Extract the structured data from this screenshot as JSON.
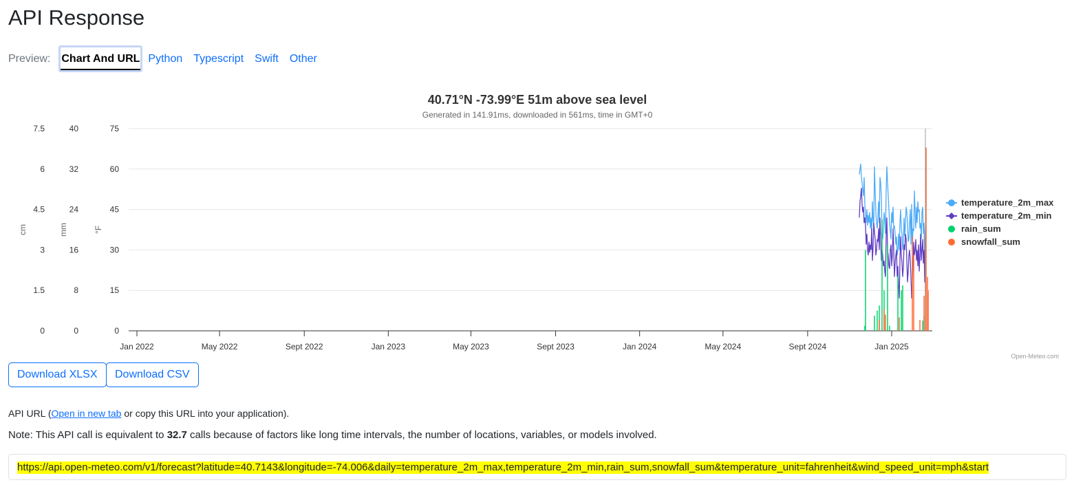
{
  "header": {
    "title": "API Response"
  },
  "tabs": {
    "label": "Preview:",
    "items": [
      "Chart And URL",
      "Python",
      "Typescript",
      "Swift",
      "Other"
    ]
  },
  "buttons": {
    "xlsx": "Download XLSX",
    "csv": "Download CSV"
  },
  "api_url": {
    "prefix": "API URL (",
    "link": "Open in new tab",
    "suffix": " or copy this URL into your application).",
    "url": "https://api.open-meteo.com/v1/forecast?latitude=40.7143&longitude=-74.006&daily=temperature_2m_max,temperature_2m_min,rain_sum,snowfall_sum&temperature_unit=fahrenheit&wind_speed_unit=mph&start"
  },
  "note": {
    "prefix": "Note: This API call is equivalent to ",
    "value": "32.7",
    "suffix": " calls because of factors like long time intervals, the number of locations, variables, or models involved."
  },
  "chart_data": {
    "type": "line",
    "title": "40.71°N -73.99°E 51m above sea level",
    "subtitle": "Generated in 141.91ms, downloaded in 561ms, time in GMT+0",
    "credit": "Open-Meteo.com",
    "x_start": "2022-01-01",
    "x_end": "2025-02-28",
    "data_start": "2024-11-15",
    "xticks": [
      {
        "label": "Jan 2022",
        "date": "2022-01-01"
      },
      {
        "label": "May 2022",
        "date": "2022-05-01"
      },
      {
        "label": "Sept 2022",
        "date": "2022-09-01"
      },
      {
        "label": "Jan 2023",
        "date": "2023-01-01"
      },
      {
        "label": "May 2023",
        "date": "2023-05-01"
      },
      {
        "label": "Sept 2023",
        "date": "2023-09-01"
      },
      {
        "label": "Jan 2024",
        "date": "2024-01-01"
      },
      {
        "label": "May 2024",
        "date": "2024-05-01"
      },
      {
        "label": "Sept 2024",
        "date": "2024-09-01"
      },
      {
        "label": "Jan 2025",
        "date": "2025-01-01"
      }
    ],
    "axes": [
      {
        "label": "cm",
        "range": [
          0,
          7.5
        ],
        "ticks": [
          "0",
          "1.5",
          "3",
          "4.5",
          "6",
          "7.5"
        ]
      },
      {
        "label": "mm",
        "range": [
          0,
          40
        ],
        "ticks": [
          "0",
          "8",
          "16",
          "24",
          "32",
          "40"
        ]
      },
      {
        "label": "°F",
        "range": [
          0,
          75
        ],
        "ticks": [
          "0",
          "15",
          "30",
          "45",
          "60",
          "75"
        ]
      }
    ],
    "series": [
      {
        "name": "temperature_2m_max",
        "color": "#4dabf7",
        "axis": 2,
        "values": [
          58,
          60,
          62,
          57,
          55,
          52,
          50,
          57,
          47,
          43,
          40,
          45,
          39,
          43,
          40,
          44,
          38,
          42,
          36,
          48,
          41,
          39,
          61,
          52,
          44,
          40,
          38,
          42,
          48,
          40,
          57,
          55,
          50,
          36,
          34,
          38,
          44,
          41,
          36,
          52,
          61,
          55,
          50,
          45,
          40,
          37,
          34,
          44,
          40,
          46,
          38,
          39,
          36,
          32,
          35,
          28,
          30,
          36,
          30,
          40,
          45,
          38,
          36,
          30,
          33,
          42,
          35,
          40,
          46,
          44,
          40,
          33,
          34,
          40,
          45,
          32,
          47,
          30,
          38,
          37,
          52,
          44,
          38,
          46,
          40,
          48,
          44,
          45,
          38,
          40,
          34,
          44,
          46,
          36,
          40,
          20,
          38
        ]
      },
      {
        "name": "temperature_2m_min",
        "color": "#5f3dc4",
        "axis": 2,
        "values": [
          42,
          48,
          50,
          53,
          47,
          44,
          46,
          40,
          42,
          39,
          32,
          36,
          30,
          28,
          33,
          29,
          32,
          30,
          38,
          26,
          31,
          40,
          37,
          34,
          28,
          30,
          34,
          33,
          38,
          30,
          42,
          35,
          26,
          30,
          28,
          24,
          26,
          22,
          20,
          35,
          42,
          30,
          28,
          24,
          23,
          30,
          32,
          24,
          28,
          38,
          30,
          20,
          25,
          28,
          30,
          20,
          24,
          17,
          12,
          26,
          35,
          28,
          25,
          20,
          24,
          32,
          30,
          36,
          34,
          26,
          18,
          22,
          28,
          30,
          26,
          20,
          12,
          18,
          25,
          33,
          28,
          30,
          34,
          26,
          30,
          24,
          32,
          22,
          28,
          36,
          26,
          30,
          34,
          25,
          30,
          18,
          38
        ]
      },
      {
        "name": "rain_sum",
        "color": "#00d26a",
        "axis": 1,
        "type": "bar",
        "values": [
          0,
          0,
          0,
          0,
          0,
          0,
          0,
          0,
          1,
          16,
          0,
          0,
          0,
          0,
          0,
          0,
          0,
          0,
          0,
          0,
          0,
          0,
          3,
          0,
          0,
          0,
          4,
          0,
          0,
          5,
          0,
          0,
          0,
          22,
          0,
          0,
          8,
          0,
          0,
          0,
          0,
          17,
          0,
          0,
          1,
          0,
          0,
          0,
          0,
          0,
          0,
          0,
          0,
          0,
          0,
          0,
          11,
          0,
          0,
          0,
          0,
          8,
          0,
          9,
          0,
          0,
          0,
          0,
          0,
          0,
          0,
          0,
          0,
          0,
          0,
          0,
          0,
          0,
          0,
          0,
          0,
          0,
          0,
          0,
          0,
          0,
          0,
          0,
          0,
          0,
          0,
          0,
          2,
          0,
          3,
          0,
          0
        ]
      },
      {
        "name": "snowfall_sum",
        "color": "#ff6b35",
        "axis": 0,
        "type": "bar",
        "values": [
          0,
          0,
          0,
          0,
          0,
          0,
          0,
          0,
          0,
          0,
          0,
          0,
          0,
          0,
          0,
          0,
          0,
          0,
          0,
          0,
          0,
          0,
          0,
          0,
          0,
          0,
          0,
          0,
          0,
          0.4,
          0,
          0,
          0,
          0,
          0,
          0,
          0.8,
          0,
          0.6,
          0,
          0,
          0,
          0,
          0,
          0,
          0,
          0,
          0,
          0,
          0,
          0,
          0,
          0,
          0,
          0,
          0,
          0,
          0,
          0.5,
          0,
          0,
          0,
          0,
          0,
          0,
          0,
          0,
          0,
          0,
          0,
          0,
          0,
          0,
          0,
          0,
          0,
          0,
          3.5,
          0,
          2.8,
          0,
          0,
          0,
          0,
          0,
          0,
          0,
          0,
          0.4,
          0,
          0,
          0,
          0,
          0,
          1.3,
          0,
          3.5,
          6.8,
          0,
          2.0,
          1.5,
          0
        ]
      }
    ]
  }
}
